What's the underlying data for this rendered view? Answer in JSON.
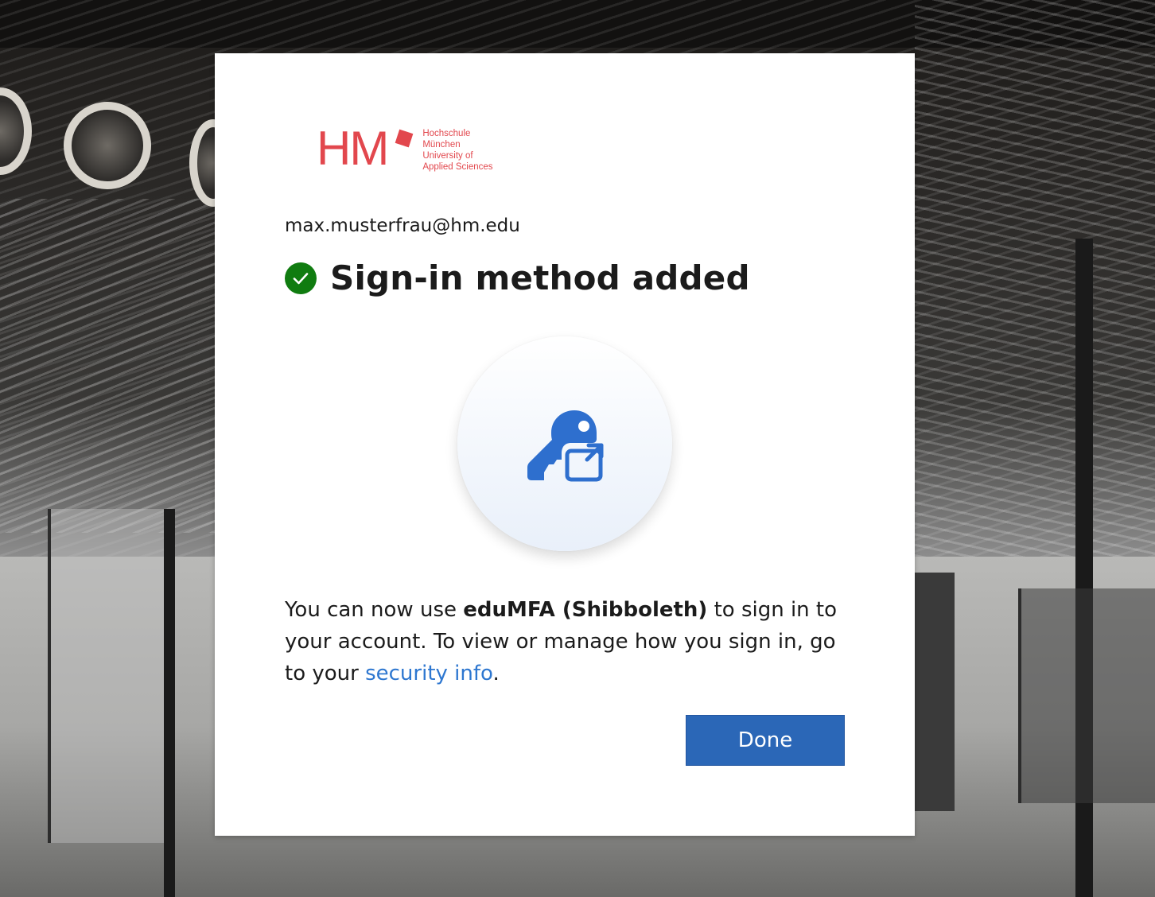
{
  "background": {
    "description_colors": {
      "dark": "#1c1a18",
      "floor": "#a7a7a5"
    }
  },
  "logo": {
    "mark": "HM",
    "lines": [
      "Hochschule",
      "München",
      "University of",
      "Applied Sciences"
    ],
    "color": "#e2474d"
  },
  "dialog": {
    "user_email": "max.musterfrau@hm.edu",
    "title": "Sign-in method added",
    "status_icon": "check-circle-icon",
    "status_color": "#107c10",
    "method_icon": "key-external-link-icon",
    "method_icon_color": "#2e6fce",
    "message": {
      "prefix": "You can now use ",
      "method_name": "eduMFA (Shibboleth)",
      "middle": " to sign in to your account. To view or manage how you sign in, go to your ",
      "link_text": "security info",
      "suffix": "."
    },
    "done_label": "Done",
    "accent_color": "#2b67b7"
  }
}
